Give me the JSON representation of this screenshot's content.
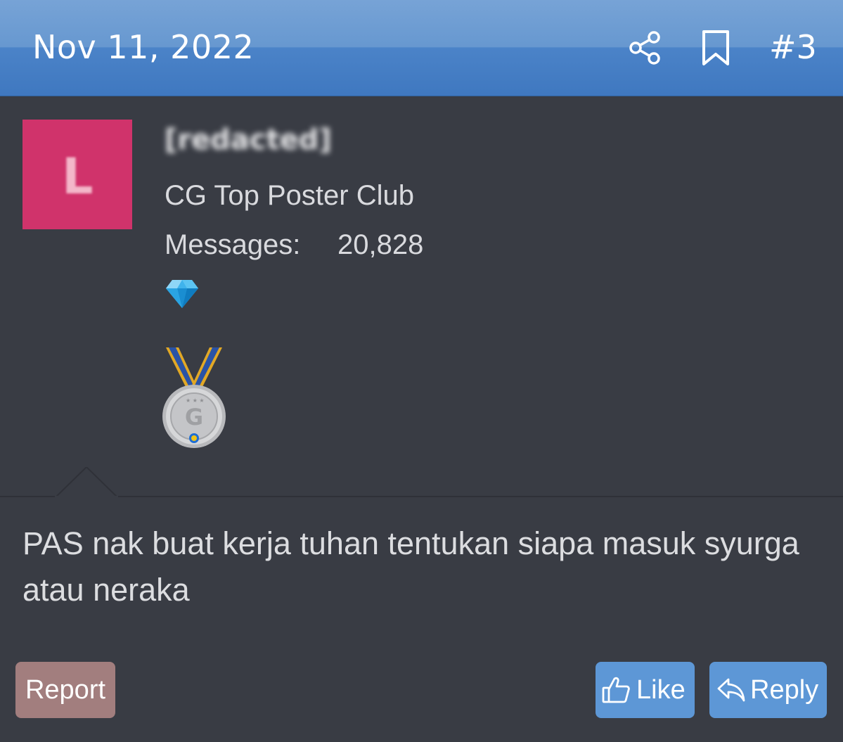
{
  "post": {
    "date": "Nov 11, 2022",
    "number": "#3",
    "icons": {
      "share": "share-icon",
      "bookmark": "bookmark-icon"
    }
  },
  "user": {
    "avatar_letter": "L",
    "avatar_color": "#d0336b",
    "username": "[redacted]",
    "title": "CG Top Poster Club",
    "messages_label": "Messages:",
    "messages_count": "20,828",
    "badges": [
      "diamond-icon",
      "silver-medal-icon"
    ]
  },
  "body": {
    "text": "PAS nak buat kerja tuhan tentukan siapa masuk syurga atau neraka"
  },
  "actions": {
    "report_label": "Report",
    "like_label": "Like",
    "reply_label": "Reply"
  },
  "colors": {
    "header": "#4b83c8",
    "background": "#393c44",
    "button": "#5d97d6",
    "report_button": "#a27e7e"
  }
}
